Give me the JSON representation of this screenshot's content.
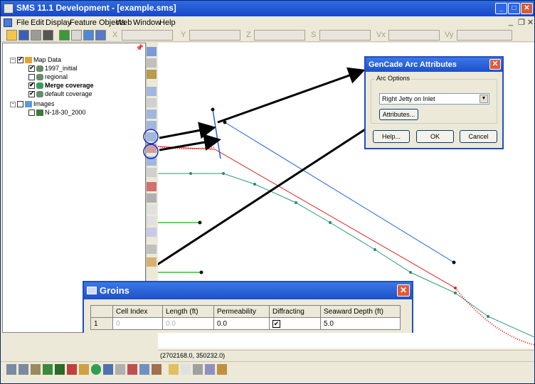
{
  "window": {
    "title": "SMS 11.1 Development - [example.sms]",
    "controls": {
      "minimize": "_",
      "maximize": "□",
      "close": "✕",
      "mdi_min": "_",
      "mdi_restore": "❐",
      "mdi_close": "✕"
    }
  },
  "menu": [
    "File",
    "Edit",
    "Display",
    "Feature Objects",
    "Web",
    "Window",
    "Help"
  ],
  "coords": {
    "x_label": "X",
    "y_label": "Y",
    "z_label": "Z",
    "s_label": "S",
    "vx_label": "Vx",
    "vy_label": "Vy"
  },
  "tree": {
    "root": "Map Data",
    "coverages": [
      {
        "label": "1997_initial",
        "checked": true
      },
      {
        "label": "regional",
        "checked": false
      },
      {
        "label": "Merge coverage",
        "checked": true,
        "bold": true
      },
      {
        "label": "default coverage",
        "checked": true
      }
    ],
    "images_folder": "Images",
    "images": [
      {
        "label": "N-18-30_2000",
        "checked": false
      }
    ]
  },
  "gencade_dialog": {
    "title": "GenCade Arc Attributes",
    "group_label": "Arc Options",
    "selected_option": "Right Jetty on Inlet",
    "attributes_button": "Attributes...",
    "help_button": "Help...",
    "ok_button": "OK",
    "cancel_button": "Cancel"
  },
  "groins_dialog": {
    "title": "Groins",
    "columns": [
      "",
      "Cell Index",
      "Length (ft)",
      "Permeability",
      "Diffracting",
      "Seaward Depth (ft)"
    ],
    "rows": [
      {
        "row": "1",
        "cell_index": "0",
        "length": "0.0",
        "permeability": "0.0",
        "diffracting": true,
        "seaward_depth": "5.0"
      }
    ]
  },
  "status": {
    "coordinates": "(2702168.0, 350232.0)"
  },
  "colors": {
    "title_bar": "#1e50c8",
    "red_arc": "#e02020",
    "blue_arc": "#2060e0",
    "green_arc": "#2a9a7a",
    "bright_green": "#20d020",
    "highlight_circle": "#1030c0"
  }
}
